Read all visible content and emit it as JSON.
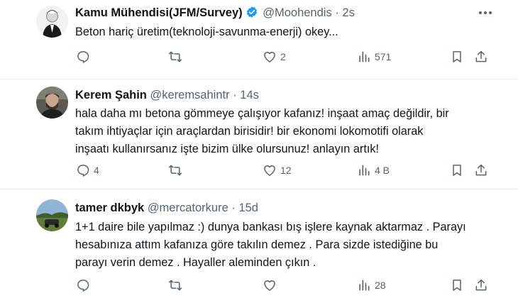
{
  "tweets": [
    {
      "name": "Kamu Mühendisi(JFM/Survey)",
      "handle": "@Moohendis",
      "separator": "·",
      "time": "2s",
      "verified": true,
      "lines": [
        "Beton hariç üretim(teknoloji-savunma-enerji) okey..."
      ],
      "replies": "",
      "retweets": "",
      "likes": "2",
      "views": "571"
    },
    {
      "name": "Kerem Şahin",
      "handle": "@keremsahintr",
      "separator": "·",
      "time": "14s",
      "verified": false,
      "lines": [
        "hala daha mı betona gömmeye çalışıyor kafanız! inşaat amaç değildir, bir",
        "takım ihtiyaçlar için araçlardan birisidir! bir ekonomi lokomotifi olarak",
        "inşaatı kullanırsanız işte bizim ülke olursunuz! anlayın artık!"
      ],
      "replies": "4",
      "retweets": "",
      "likes": "12",
      "views": "4 B"
    },
    {
      "name": "tamer dkbyk",
      "handle": "@mercatorkure",
      "separator": "·",
      "time": "15d",
      "verified": false,
      "lines": [
        "1+1 daire bile yapılmaz :) dunya bankası  bış işlere kaynak aktarmaz . Parayı",
        "hesabınıza attım kafanıza göre takılın demez .  Para sizde istediğine bu",
        "parayı verin demez . Hayaller  aleminden çıkın ."
      ],
      "replies": "",
      "retweets": "",
      "likes": "",
      "views": "28"
    }
  ],
  "colors": {
    "text": "#0f1419",
    "secondary": "#536471",
    "verified": "#1d9bf0",
    "divider": "#e6ecf0"
  }
}
